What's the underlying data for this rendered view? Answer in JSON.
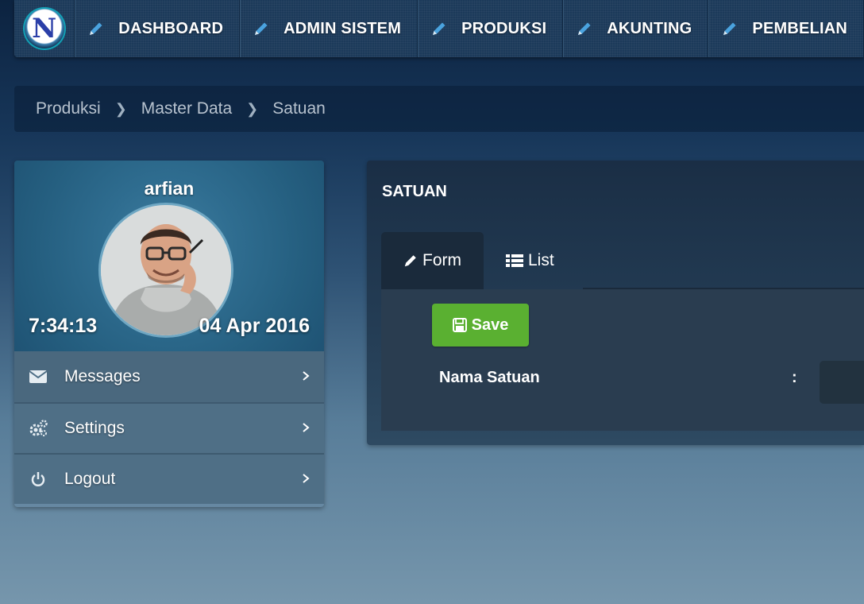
{
  "nav": {
    "logo_letter": "N",
    "items": [
      {
        "label": "DASHBOARD",
        "icon": "pencil-icon"
      },
      {
        "label": "ADMIN SISTEM",
        "icon": "pencil-icon"
      },
      {
        "label": "PRODUKSI",
        "icon": "pencil-icon"
      },
      {
        "label": "AKUNTING",
        "icon": "pencil-icon"
      },
      {
        "label": "PEMBELIAN",
        "icon": "pencil-icon"
      }
    ]
  },
  "breadcrumb": [
    "Produksi",
    "Master Data",
    "Satuan"
  ],
  "profile": {
    "username": "arfian",
    "time": "7:34:13",
    "date": "04 Apr 2016",
    "menu": [
      {
        "label": "Messages",
        "icon": "envelope-icon"
      },
      {
        "label": "Settings",
        "icon": "gears-icon"
      },
      {
        "label": "Logout",
        "icon": "power-icon"
      }
    ]
  },
  "main": {
    "title": "SATUAN",
    "tabs": [
      {
        "label": "Form",
        "icon": "pencil-icon",
        "active": true
      },
      {
        "label": "List",
        "icon": "list-icon",
        "active": false
      }
    ],
    "save_label": "Save",
    "field_label": "Nama Satuan",
    "colon": ":",
    "field_value": ""
  },
  "colors": {
    "accent_green": "#5ab031",
    "pencil_blue": "#4aa3df",
    "nav_bg": "#1c3a5a"
  }
}
